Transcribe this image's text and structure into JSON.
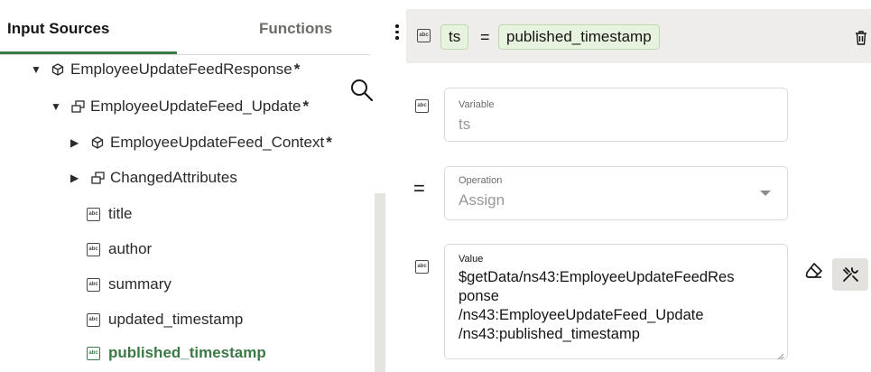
{
  "tabs": [
    {
      "label": "Input Sources",
      "active": true
    },
    {
      "label": "Functions",
      "active": false
    }
  ],
  "tree": {
    "items": [
      {
        "label": "EmployeeUpdateFeedResponse",
        "required": "*",
        "icon": "complex-element-icon",
        "expanded": true
      },
      {
        "label": "EmployeeUpdateFeed_Update",
        "required": "*",
        "icon": "repeating-element-icon",
        "expanded": true
      },
      {
        "label": "EmployeeUpdateFeed_Context",
        "required": "*",
        "icon": "complex-element-icon",
        "expanded": false
      },
      {
        "label": "ChangedAttributes",
        "required": "",
        "icon": "repeating-element-icon",
        "expanded": false
      },
      {
        "label": "title",
        "icon": "string-field-icon"
      },
      {
        "label": "author",
        "icon": "string-field-icon"
      },
      {
        "label": "summary",
        "icon": "string-field-icon"
      },
      {
        "label": "updated_timestamp",
        "icon": "string-field-icon"
      },
      {
        "label": "published_timestamp",
        "icon": "string-field-icon",
        "selected": true
      }
    ]
  },
  "header": {
    "variable": "ts",
    "operator": "=",
    "value": "published_timestamp"
  },
  "fields": {
    "variable": {
      "label": "Variable",
      "value": "ts"
    },
    "operation": {
      "label": "Operation",
      "value": "Assign",
      "operator": "="
    },
    "value": {
      "label": "Value",
      "value": "$getData/ns43:EmployeeUpdateFeedRes\nponse\n/ns43:EmployeeUpdateFeed_Update\n/ns43:published_timestamp"
    }
  },
  "icons": {
    "type_badge": "abc",
    "accent": "#3b7a46",
    "pill_bg": "#e7f3de",
    "header_bg": "#efedeb"
  }
}
